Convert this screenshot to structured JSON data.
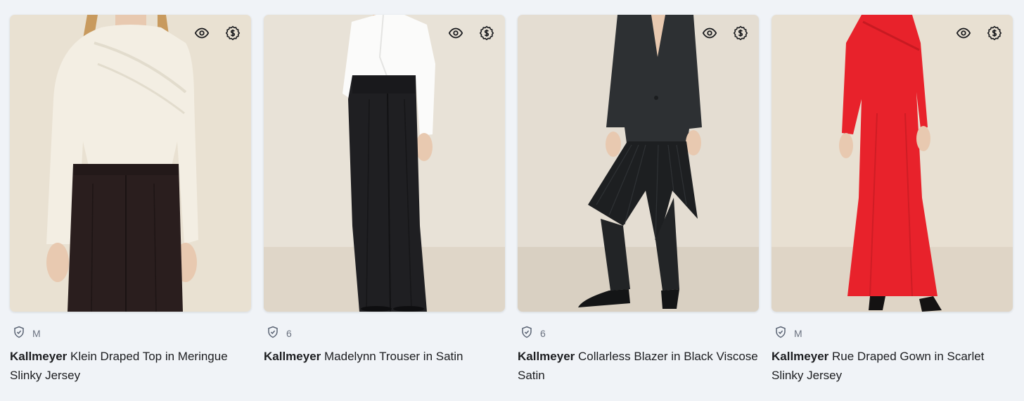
{
  "products": [
    {
      "brand": "Kallmeyer",
      "name": "Klein Draped Top in Meringue Slinky Jersey",
      "size": "M",
      "background": "#e9e1d2",
      "outfit": "ivory-top-black-trousers"
    },
    {
      "brand": "Kallmeyer",
      "name": "Madelynn Trouser in Satin",
      "size": "6",
      "background": "#e8e2d7",
      "outfit": "white-shirt-black-wide-trousers"
    },
    {
      "brand": "Kallmeyer",
      "name": "Collarless Blazer in Black Viscose Satin",
      "size": "6",
      "background": "#e4ddd2",
      "outfit": "black-blazer-pleated-skirt"
    },
    {
      "brand": "Kallmeyer",
      "name": "Rue Draped Gown in Scarlet Slinky Jersey",
      "size": "M",
      "background": "#e8e0d2",
      "outfit": "red-gown"
    }
  ],
  "icons": {
    "view": "eye-icon",
    "price": "dollar-badge-icon",
    "verified": "shield-check-icon"
  },
  "colors": {
    "page_background": "#f0f3f7",
    "text": "#1c1d20",
    "muted": "#6b7280",
    "red_gown": "#e8222b"
  }
}
